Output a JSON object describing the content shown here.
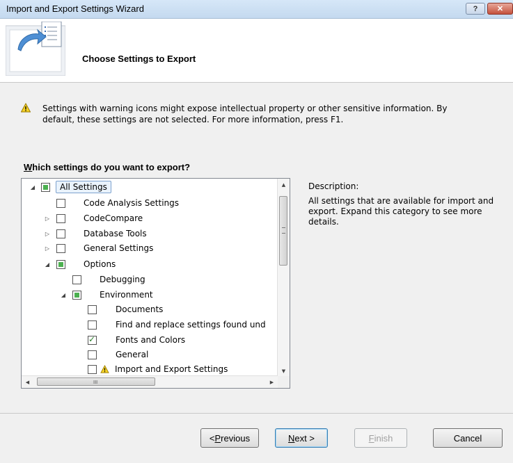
{
  "window": {
    "title": "Import and Export Settings Wizard",
    "help_label": "?",
    "close_label": "✕"
  },
  "header": {
    "title": "Choose Settings to Export"
  },
  "warning": {
    "text": "Settings with warning icons might expose intellectual property or other sensitive information. By default, these settings are not selected. For more information, press F1."
  },
  "question": {
    "prefix": "W",
    "rest": "hich settings do you want to export?"
  },
  "tree": {
    "items": [
      {
        "label": "All Settings",
        "state": "partial",
        "expander": "expanded"
      },
      {
        "label": "Code Analysis Settings",
        "state": "unchecked",
        "expander": "none"
      },
      {
        "label": "CodeCompare",
        "state": "unchecked",
        "expander": "collapsed"
      },
      {
        "label": "Database Tools",
        "state": "unchecked",
        "expander": "collapsed"
      },
      {
        "label": "General Settings",
        "state": "unchecked",
        "expander": "collapsed"
      },
      {
        "label": "Options",
        "state": "partial",
        "expander": "expanded"
      },
      {
        "label": "Debugging",
        "state": "unchecked",
        "expander": "none"
      },
      {
        "label": "Environment",
        "state": "partial",
        "expander": "expanded"
      },
      {
        "label": "Documents",
        "state": "unchecked",
        "expander": "none"
      },
      {
        "label": "Find and replace settings found und",
        "state": "unchecked",
        "expander": "none"
      },
      {
        "label": "Fonts and Colors",
        "state": "checked",
        "expander": "none"
      },
      {
        "label": "General",
        "state": "unchecked",
        "expander": "none"
      },
      {
        "label": "Import and Export Settings",
        "state": "unchecked",
        "expander": "none",
        "warning": true
      }
    ]
  },
  "description": {
    "label": "Description:",
    "text": "All settings that are available for import and export. Expand this category to see more details."
  },
  "buttons": {
    "previous": {
      "mnemonic": "P",
      "before": "< ",
      "after": "revious"
    },
    "next": {
      "mnemonic": "N",
      "before": "",
      "after": "ext >"
    },
    "finish": {
      "mnemonic": "F",
      "before": "",
      "after": "inish"
    },
    "cancel": "Cancel"
  },
  "colors": {
    "accent_green": "#4cb050",
    "warning_yellow": "#f5d327",
    "selection_border": "#7da2ce"
  }
}
